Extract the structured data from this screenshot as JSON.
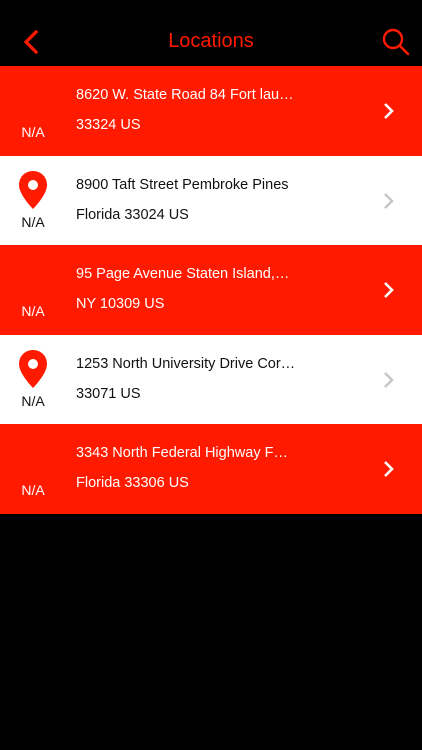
{
  "header": {
    "title": "Locations",
    "back_icon": "back-chevron-icon",
    "search_icon": "search-icon"
  },
  "colors": {
    "accent": "#ff1a00",
    "background": "#000000",
    "row_alt": "#ffffff",
    "chevron_light": "#ffffff",
    "chevron_dark": "#c8c8c8"
  },
  "locations": [
    {
      "address_line1": "8620 W. State Road 84 Fort lau…",
      "address_line2": "33324 US",
      "distance": "N/A",
      "style": "red"
    },
    {
      "address_line1": "8900 Taft Street  Pembroke Pines",
      "address_line2": "Florida 33024 US",
      "distance": "N/A",
      "style": "white"
    },
    {
      "address_line1": "95 Page Avenue Staten Island,…",
      "address_line2": "NY 10309 US",
      "distance": "N/A",
      "style": "red"
    },
    {
      "address_line1": "1253 North University Drive Cor…",
      "address_line2": "33071 US",
      "distance": "N/A",
      "style": "white"
    },
    {
      "address_line1": "3343 North Federal Highway  F…",
      "address_line2": "Florida 33306 US",
      "distance": "N/A",
      "style": "red"
    }
  ]
}
